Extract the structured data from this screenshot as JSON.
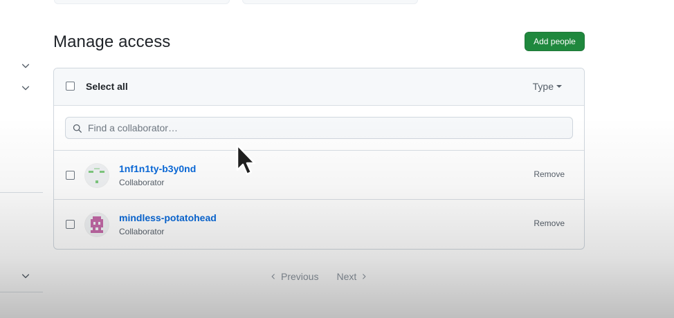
{
  "header": {
    "title": "Manage access",
    "add_button_label": "Add people"
  },
  "list": {
    "select_all_label": "Select all",
    "type_filter_label": "Type",
    "search_placeholder": "Find a collaborator…",
    "collaborators": [
      {
        "name": "1nf1n1ty-b3y0nd",
        "role": "Collaborator",
        "action": "Remove",
        "avatar_color": "#7fc97f"
      },
      {
        "name": "mindless-potatohead",
        "role": "Collaborator",
        "action": "Remove",
        "avatar_color": "#c46aa8"
      }
    ]
  },
  "pagination": {
    "previous_label": "Previous",
    "next_label": "Next"
  },
  "colors": {
    "primary_button": "#1f883d",
    "link": "#0969da"
  }
}
